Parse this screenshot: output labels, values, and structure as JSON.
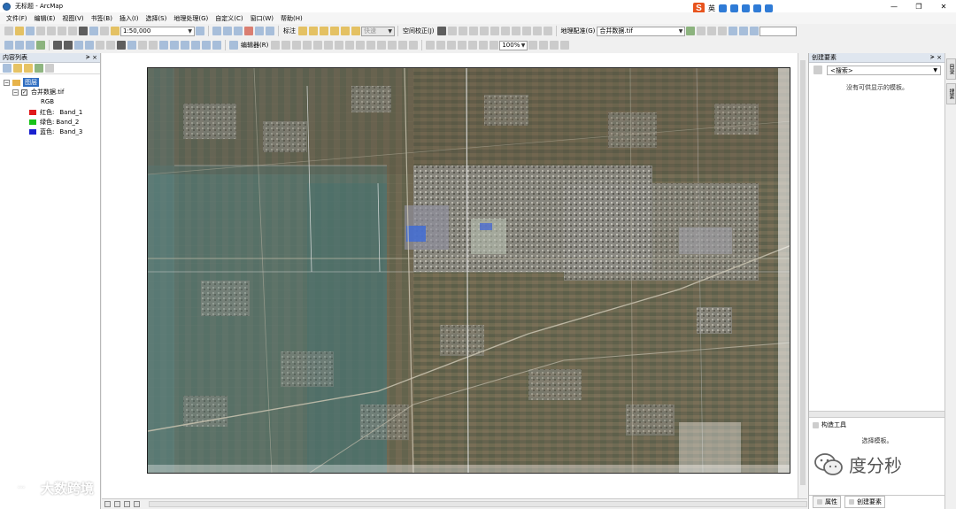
{
  "window": {
    "title": "无标题 - ArcMap",
    "controls": [
      "—",
      "❐",
      "✕"
    ]
  },
  "menu": [
    "文件(F)",
    "编辑(E)",
    "视图(V)",
    "书签(B)",
    "插入(I)",
    "选择(S)",
    "地理处理(G)",
    "自定义(C)",
    "窗口(W)",
    "帮助(H)"
  ],
  "ime": {
    "logo": "S",
    "lang": "英"
  },
  "toolbar": {
    "scale": "1:50,000",
    "label_tool": "标注",
    "fast": "快速",
    "spatial_adjust": "空间校正(J)",
    "georef": "地理配准(G)",
    "layer_select": "合并数据.tif",
    "editor": "编辑器(R)",
    "zoom": "100%"
  },
  "toc": {
    "title": "内容列表",
    "pin": "ᗒ ×",
    "layers_label": "图层",
    "layer_name": "合并数据.tif",
    "rgb_label": "RGB",
    "bands": [
      {
        "label": "红色:",
        "band": "Band_1",
        "color": "#e0191b"
      },
      {
        "label": "绿色:",
        "band": "Band_2",
        "color": "#18c318"
      },
      {
        "label": "蓝色:",
        "band": "Band_3",
        "color": "#1a20cf"
      }
    ]
  },
  "create_features": {
    "title": "创建要素",
    "pin": "ᗒ ×",
    "search_placeholder": "<搜索>",
    "no_templates": "没有可供显示的模板。",
    "construct_title": "构造工具",
    "construct_msg": "选择模板。",
    "tabs": [
      "属性",
      "创建要素"
    ]
  },
  "side_tabs": [
    "目录",
    "搜索"
  ],
  "watermarks": {
    "left": "大数跨境",
    "right": "度分秒"
  }
}
